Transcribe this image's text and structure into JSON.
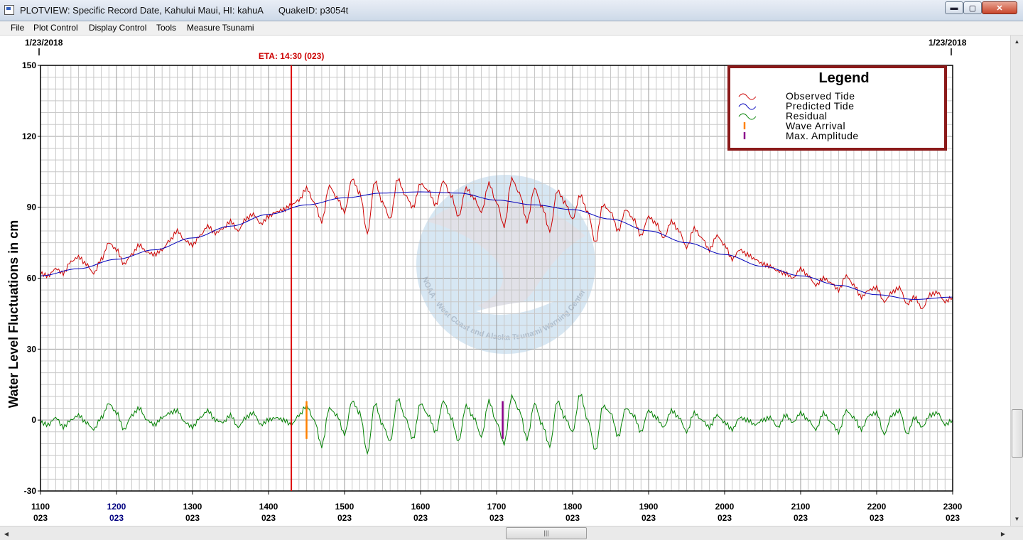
{
  "window": {
    "title": "PLOTVIEW: Specific Record Date, Kahului Maui, HI: kahuA      QuakeID: p3054t",
    "min_glyph": "▬",
    "max_glyph": "▢",
    "close_glyph": "✕"
  },
  "menu": [
    "File",
    "Plot Control",
    "Display Control",
    "Tools",
    "Measure Tsunami"
  ],
  "plot": {
    "date_left": "1/23/2018",
    "date_right": "1/23/2018",
    "eta_label": "ETA: 14:30 (023)",
    "y_label": "Water Level Fluctuations in cm",
    "watermark": "NOAA - West Coast and Alaska Tsunami Warning Center",
    "legend": {
      "title": "Legend",
      "items": [
        {
          "label": "Observed Tide",
          "color": "#cc0000"
        },
        {
          "label": "Predicted Tide",
          "color": "#0000bb"
        },
        {
          "label": "Residual",
          "color": "#008000"
        },
        {
          "label": "Wave Arrival",
          "color": "#ff8000"
        },
        {
          "label": "Max. Amplitude",
          "color": "#8b008b"
        }
      ]
    },
    "highlight_tick_color": "#000080"
  },
  "chart_data": {
    "type": "line",
    "ylabel": "Water Level Fluctuations in cm",
    "ylim": [
      -30,
      150
    ],
    "yticks": [
      -30,
      0,
      30,
      60,
      90,
      120,
      150
    ],
    "xlim": [
      1100,
      2300
    ],
    "xticks": [
      {
        "value": 1100,
        "time": "1100",
        "day": "023"
      },
      {
        "value": 1200,
        "time": "1200",
        "day": "023",
        "highlight": true
      },
      {
        "value": 1300,
        "time": "1300",
        "day": "023"
      },
      {
        "value": 1400,
        "time": "1400",
        "day": "023"
      },
      {
        "value": 1500,
        "time": "1500",
        "day": "023"
      },
      {
        "value": 1600,
        "time": "1600",
        "day": "023"
      },
      {
        "value": 1700,
        "time": "1700",
        "day": "023"
      },
      {
        "value": 1800,
        "time": "1800",
        "day": "023"
      },
      {
        "value": 1900,
        "time": "1900",
        "day": "023"
      },
      {
        "value": 2000,
        "time": "2000",
        "day": "023"
      },
      {
        "value": 2100,
        "time": "2100",
        "day": "023"
      },
      {
        "value": 2200,
        "time": "2200",
        "day": "023"
      },
      {
        "value": 2300,
        "time": "2300",
        "day": "023"
      }
    ],
    "grid": true,
    "eta_time": 1430,
    "wave_arrival_time": 1450,
    "max_amplitude_time": 1708,
    "series": [
      {
        "name": "Observed Tide",
        "color": "#cc0000",
        "x": [
          1100,
          1110,
          1120,
          1130,
          1140,
          1150,
          1160,
          1170,
          1180,
          1190,
          1200,
          1210,
          1220,
          1230,
          1240,
          1250,
          1260,
          1270,
          1280,
          1290,
          1300,
          1310,
          1320,
          1330,
          1340,
          1350,
          1360,
          1370,
          1380,
          1390,
          1400,
          1410,
          1420,
          1430,
          1440,
          1450,
          1460,
          1470,
          1480,
          1490,
          1500,
          1510,
          1520,
          1530,
          1540,
          1550,
          1560,
          1570,
          1580,
          1590,
          1600,
          1610,
          1620,
          1630,
          1640,
          1650,
          1660,
          1670,
          1680,
          1690,
          1700,
          1710,
          1720,
          1730,
          1740,
          1750,
          1760,
          1770,
          1780,
          1790,
          1800,
          1810,
          1820,
          1830,
          1840,
          1850,
          1860,
          1870,
          1880,
          1890,
          1900,
          1910,
          1920,
          1930,
          1940,
          1950,
          1960,
          1970,
          1980,
          1990,
          2000,
          2010,
          2020,
          2030,
          2040,
          2050,
          2060,
          2070,
          2080,
          2090,
          2100,
          2110,
          2120,
          2130,
          2140,
          2150,
          2160,
          2170,
          2180,
          2190,
          2200,
          2210,
          2220,
          2230,
          2240,
          2250,
          2260,
          2270,
          2280,
          2290,
          2300
        ],
        "y": [
          62,
          61,
          64,
          62,
          67,
          69,
          66,
          62,
          68,
          75,
          72,
          66,
          70,
          74,
          71,
          70,
          72,
          76,
          80,
          76,
          74,
          78,
          82,
          79,
          81,
          84,
          80,
          85,
          87,
          83,
          86,
          88,
          89,
          91,
          93,
          98,
          92,
          84,
          99,
          94,
          88,
          102,
          96,
          79,
          101,
          92,
          85,
          102,
          95,
          90,
          100,
          97,
          91,
          101,
          95,
          86,
          98,
          94,
          88,
          100,
          92,
          82,
          102,
          96,
          84,
          98,
          90,
          80,
          97,
          92,
          85,
          95,
          88,
          75,
          91,
          88,
          80,
          89,
          85,
          78,
          86,
          83,
          77,
          84,
          80,
          73,
          81,
          77,
          72,
          78,
          74,
          68,
          72,
          70,
          68,
          66,
          65,
          63,
          62,
          60,
          64,
          61,
          57,
          60,
          58,
          55,
          61,
          57,
          52,
          55,
          56,
          50,
          54,
          56,
          49,
          52,
          47,
          53,
          54,
          50,
          52
        ]
      },
      {
        "name": "Predicted Tide",
        "color": "#0000bb",
        "x": [
          1100,
          1150,
          1200,
          1250,
          1300,
          1350,
          1400,
          1450,
          1500,
          1550,
          1600,
          1650,
          1700,
          1750,
          1800,
          1850,
          1900,
          1950,
          2000,
          2050,
          2100,
          2150,
          2200,
          2250,
          2300
        ],
        "y": [
          61,
          64,
          68,
          72,
          77,
          82,
          87,
          91,
          94,
          96,
          96.5,
          96,
          93,
          91,
          89,
          85,
          80,
          75,
          70,
          65,
          61,
          57,
          53,
          51,
          52
        ]
      },
      {
        "name": "Residual",
        "color": "#008000",
        "x": [
          1100,
          1110,
          1120,
          1130,
          1140,
          1150,
          1160,
          1170,
          1180,
          1190,
          1200,
          1210,
          1220,
          1230,
          1240,
          1250,
          1260,
          1270,
          1280,
          1290,
          1300,
          1310,
          1320,
          1330,
          1340,
          1350,
          1360,
          1370,
          1380,
          1390,
          1400,
          1410,
          1420,
          1430,
          1440,
          1450,
          1460,
          1470,
          1480,
          1490,
          1500,
          1510,
          1520,
          1530,
          1540,
          1550,
          1560,
          1570,
          1580,
          1590,
          1600,
          1610,
          1620,
          1630,
          1640,
          1650,
          1660,
          1670,
          1680,
          1690,
          1700,
          1710,
          1720,
          1730,
          1740,
          1750,
          1760,
          1770,
          1780,
          1790,
          1800,
          1810,
          1820,
          1830,
          1840,
          1850,
          1860,
          1870,
          1880,
          1890,
          1900,
          1910,
          1920,
          1930,
          1940,
          1950,
          1960,
          1970,
          1980,
          1990,
          2000,
          2010,
          2020,
          2030,
          2040,
          2050,
          2060,
          2070,
          2080,
          2090,
          2100,
          2110,
          2120,
          2130,
          2140,
          2150,
          2160,
          2170,
          2180,
          2190,
          2200,
          2210,
          2220,
          2230,
          2240,
          2250,
          2260,
          2270,
          2280,
          2290,
          2300
        ],
        "y": [
          -1,
          -2,
          1,
          -3,
          0,
          2,
          -1,
          -4,
          1,
          7,
          3,
          -4,
          2,
          5,
          0,
          -2,
          1,
          3,
          4,
          -1,
          -3,
          1,
          4,
          0,
          -1,
          2,
          -3,
          1,
          3,
          -2,
          0,
          1,
          0,
          -2,
          2,
          6,
          0,
          -11,
          5,
          2,
          -6,
          8,
          3,
          -14,
          7,
          -2,
          -9,
          9,
          1,
          -8,
          7,
          2,
          -5,
          8,
          1,
          -9,
          6,
          1,
          -7,
          8,
          -1,
          -10,
          10,
          4,
          -8,
          7,
          -2,
          -11,
          8,
          1,
          -5,
          11,
          0,
          -13,
          6,
          3,
          -7,
          5,
          2,
          -5,
          4,
          1,
          -3,
          4,
          1,
          -5,
          3,
          0,
          -3,
          2,
          -1,
          -4,
          1,
          0,
          -2,
          0,
          1,
          -3,
          2,
          -1,
          3,
          0,
          -4,
          3,
          -1,
          -5,
          4,
          1,
          -4,
          2,
          3,
          -6,
          2,
          4,
          -6,
          1,
          -3,
          2,
          3,
          -2,
          0
        ]
      }
    ]
  }
}
